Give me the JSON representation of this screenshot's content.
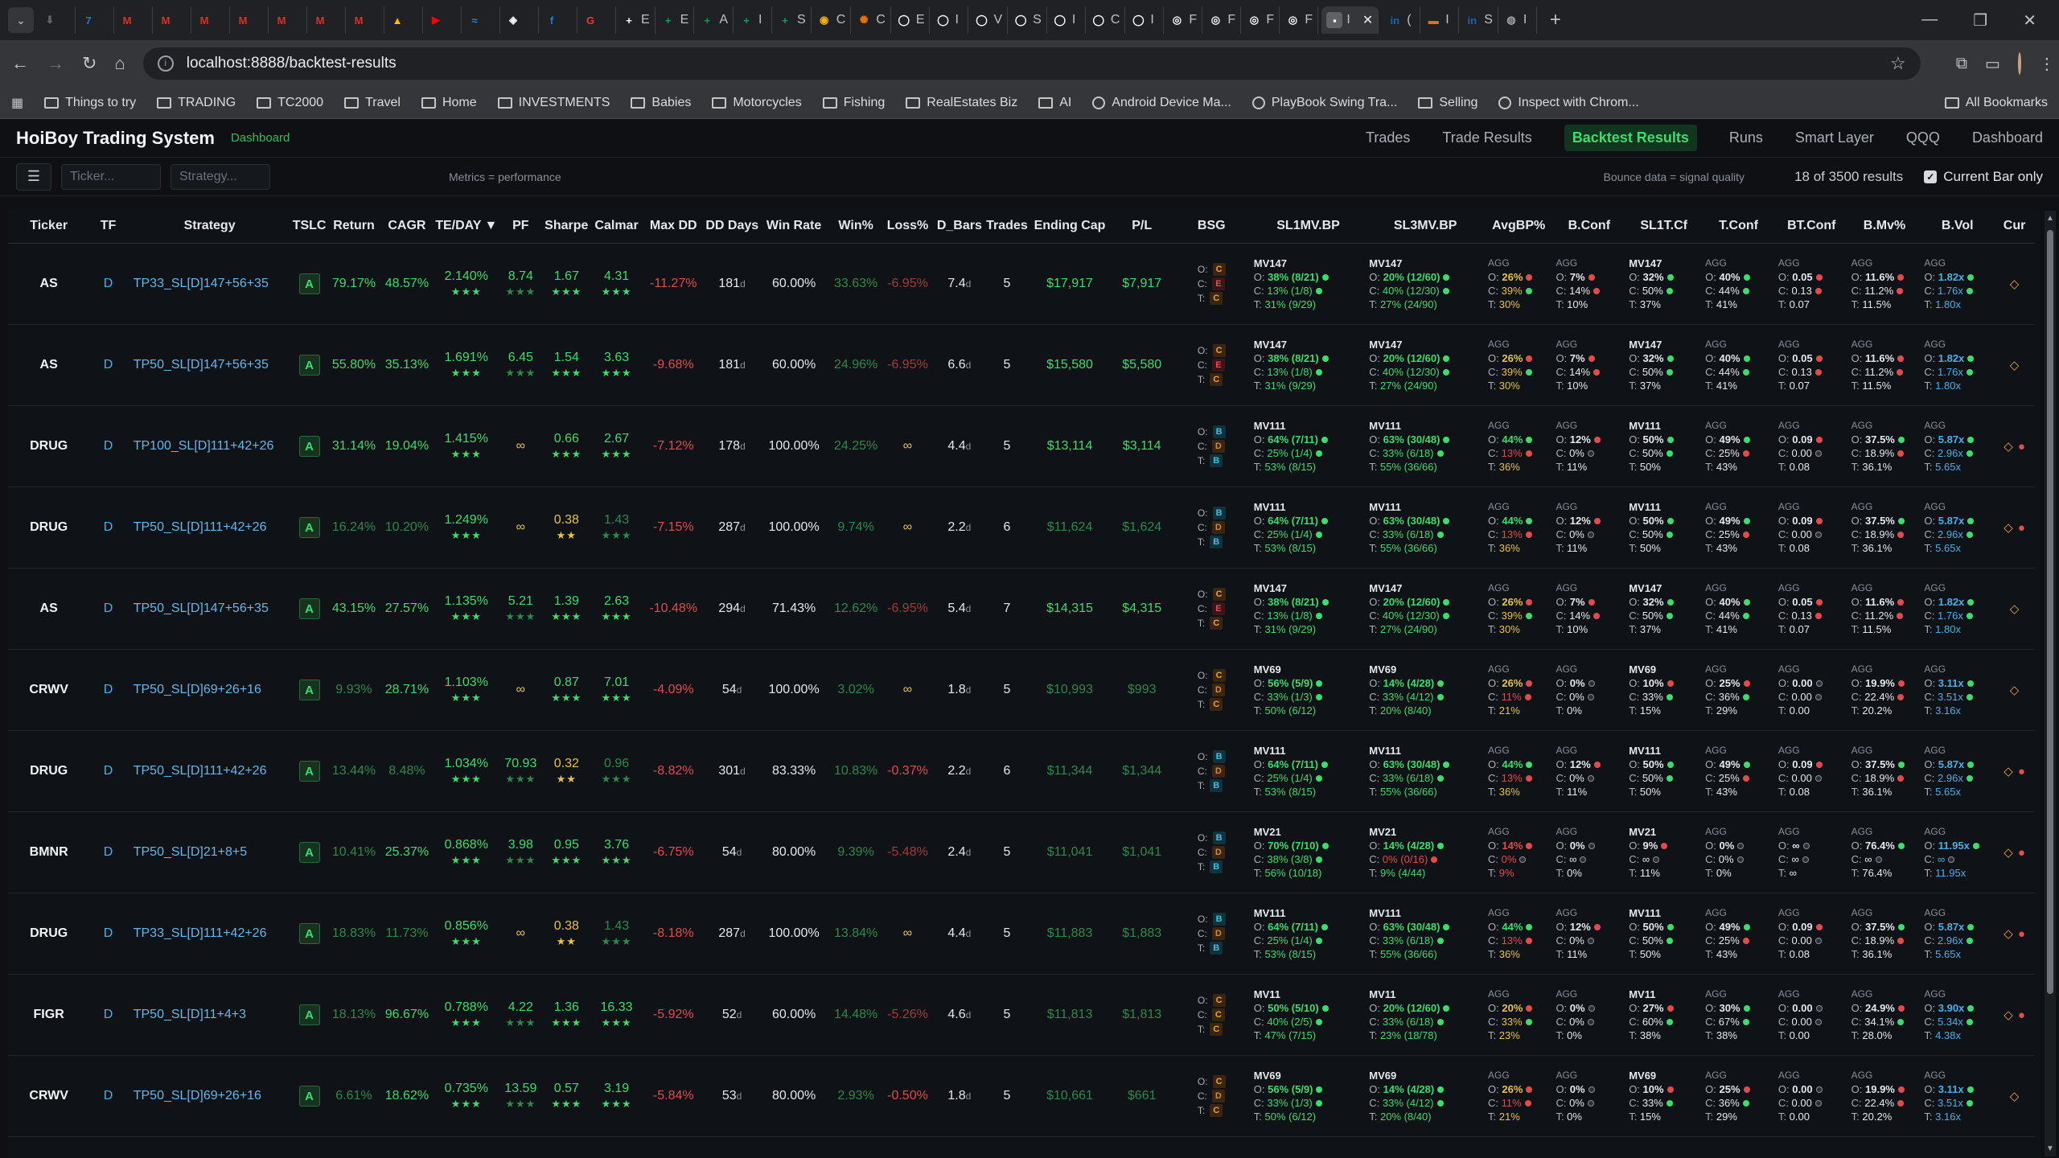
{
  "browser": {
    "tabs": [
      {
        "glyph": "⬇",
        "color": "#5f6368"
      },
      {
        "glyph": "7",
        "color": "#1a73e8"
      },
      {
        "glyph": "M",
        "color": "#d93025"
      },
      {
        "glyph": "M",
        "color": "#d93025"
      },
      {
        "glyph": "M",
        "color": "#d93025"
      },
      {
        "glyph": "M",
        "color": "#d93025"
      },
      {
        "glyph": "M",
        "color": "#d93025"
      },
      {
        "glyph": "M",
        "color": "#d93025"
      },
      {
        "glyph": "M",
        "color": "#d93025"
      },
      {
        "glyph": "▲",
        "color": "#fbbc04"
      },
      {
        "glyph": "▶",
        "color": "#ff0000"
      },
      {
        "glyph": "≈",
        "color": "#1e88e5"
      },
      {
        "glyph": "◈",
        "color": "#ffffff"
      },
      {
        "glyph": "f",
        "color": "#1877f2"
      },
      {
        "glyph": "G",
        "color": "#e53935"
      },
      {
        "glyph": "+",
        "color": "#ffffff",
        "label": "E"
      },
      {
        "glyph": "+",
        "color": "#0f9d58",
        "label": "E"
      },
      {
        "glyph": "+",
        "color": "#0f9d58",
        "label": "A"
      },
      {
        "glyph": "+",
        "color": "#0f9d58",
        "label": "I"
      },
      {
        "glyph": "+",
        "color": "#0f9d58",
        "label": "S"
      },
      {
        "glyph": "◉",
        "color": "#f4b400",
        "label": "C"
      },
      {
        "glyph": "✺",
        "color": "#e8710a",
        "label": "C"
      },
      {
        "glyph": "◯",
        "color": "#ffffff",
        "label": "E"
      },
      {
        "glyph": "◯",
        "color": "#ffffff",
        "label": "I"
      },
      {
        "glyph": "◯",
        "color": "#ffffff",
        "label": "V"
      },
      {
        "glyph": "◯",
        "color": "#ffffff",
        "label": "S"
      },
      {
        "glyph": "◯",
        "color": "#ffffff",
        "label": "I"
      },
      {
        "glyph": "◯",
        "color": "#ffffff",
        "label": "C"
      },
      {
        "glyph": "◯",
        "color": "#ffffff",
        "label": "I"
      },
      {
        "glyph": "◎",
        "color": "#ffffff",
        "label": "F"
      },
      {
        "glyph": "◎",
        "color": "#ffffff",
        "label": "F"
      },
      {
        "glyph": "◎",
        "color": "#ffffff",
        "label": "F"
      },
      {
        "glyph": "◎",
        "color": "#ffffff",
        "label": "F"
      }
    ],
    "active_tab": {
      "label": "I"
    },
    "tabs_after": [
      {
        "glyph": "in",
        "color": "#0a66c2",
        "label": "("
      },
      {
        "glyph": "▬",
        "color": "#e8710a",
        "label": "I"
      },
      {
        "glyph": "in",
        "color": "#0a66c2",
        "label": "S"
      },
      {
        "glyph": "◍",
        "color": "#9aa0a6",
        "label": "I"
      }
    ],
    "url": "localhost:8888/backtest-results",
    "bookmarks": [
      "Things to try",
      "TRADING",
      "TC2000",
      "Travel",
      "Home",
      "INVESTMENTS",
      "Babies",
      "Motorcycles",
      "Fishing",
      "RealEstates Biz",
      "AI",
      "Android Device Ma...",
      "PlayBook Swing Tra...",
      "Selling",
      "Inspect with Chrom..."
    ],
    "all_bookmarks": "All Bookmarks"
  },
  "app": {
    "brand": "HoiBoy Trading System",
    "brand_sub": "Dashboard",
    "nav": [
      "Trades",
      "Trade Results",
      "Backtest Results",
      "Runs",
      "Smart Layer",
      "QQQ",
      "Dashboard"
    ],
    "nav_active": "Backtest Results"
  },
  "filters": {
    "ticker_placeholder": "Ticker...",
    "strategy_placeholder": "Strategy...",
    "metrics_note": "Metrics = performance",
    "bounce_note": "Bounce data = signal quality",
    "result_count": "18 of 3500 results",
    "current_bar_label": "Current Bar only",
    "current_bar_checked": true
  },
  "columns": [
    "Ticker",
    "TF",
    "Strategy",
    "TSLC",
    "Return",
    "CAGR",
    "TE/DAY ▼",
    "PF",
    "Sharpe",
    "Calmar",
    "Max DD",
    "DD Days",
    "Win Rate",
    "Win%",
    "Loss%",
    "D_Bars",
    "Trades",
    "Ending Cap",
    "P/L",
    "BSG",
    "SL1MV.BP",
    "SL3MV.BP",
    "AvgBP%",
    "B.Conf",
    "SL1T.Cf",
    "T.Conf",
    "BT.Conf",
    "B.Mv%",
    "B.Vol",
    "Cur"
  ],
  "rows": [
    {
      "ticker": "AS",
      "tf": "D",
      "strategy": "TP33_SL[D]147+56+35",
      "tslc": "A",
      "ret": "79.17%",
      "cagr": "48.57%",
      "teday": "2.140%",
      "pf": "8.74",
      "sharpe": "1.67",
      "calmar": "4.31",
      "maxdd": "-11.27%",
      "dddays": "181",
      "winrate": "60.00%",
      "winp": "33.63%",
      "lossp": "-6.95%",
      "dbars": "7.4",
      "trades": "5",
      "endcap": "$17,917",
      "pl": "$7,917",
      "bsg": [
        "C",
        "E",
        "C"
      ]
    },
    {
      "ticker": "AS",
      "tf": "D",
      "strategy": "TP50_SL[D]147+56+35",
      "tslc": "A",
      "ret": "55.80%",
      "cagr": "35.13%",
      "teday": "1.691%",
      "pf": "6.45",
      "sharpe": "1.54",
      "calmar": "3.63",
      "maxdd": "-9.68%",
      "dddays": "181",
      "winrate": "60.00%",
      "winp": "24.96%",
      "lossp": "-6.95%",
      "dbars": "6.6",
      "trades": "5",
      "endcap": "$15,580",
      "pl": "$5,580",
      "bsg": [
        "C",
        "E",
        "C"
      ]
    },
    {
      "ticker": "DRUG",
      "tf": "D",
      "strategy": "TP100_SL[D]111+42+26",
      "tslc": "A",
      "ret": "31.14%",
      "cagr": "19.04%",
      "teday": "1.415%",
      "pf": "∞",
      "sharpe": "0.66",
      "calmar": "2.67",
      "maxdd": "-7.12%",
      "dddays": "178",
      "winrate": "100.00%",
      "winp": "24.25%",
      "lossp": "∞",
      "dbars": "4.4",
      "trades": "5",
      "endcap": "$13,114",
      "pl": "$3,114",
      "bsg": [
        "B",
        "D",
        "B"
      ]
    },
    {
      "ticker": "DRUG",
      "tf": "D",
      "strategy": "TP50_SL[D]111+42+26",
      "tslc": "A",
      "ret": "16.24%",
      "cagr": "10.20%",
      "teday": "1.249%",
      "pf": "∞",
      "sharpe": "0.38",
      "calmar": "1.43",
      "maxdd": "-7.15%",
      "dddays": "287",
      "winrate": "100.00%",
      "winp": "9.74%",
      "lossp": "∞",
      "dbars": "2.2",
      "trades": "6",
      "endcap": "$11,624",
      "pl": "$1,624",
      "bsg": [
        "B",
        "D",
        "B"
      ]
    },
    {
      "ticker": "AS",
      "tf": "D",
      "strategy": "TP50_SL[D]147+56+35",
      "tslc": "A",
      "ret": "43.15%",
      "cagr": "27.57%",
      "teday": "1.135%",
      "pf": "5.21",
      "sharpe": "1.39",
      "calmar": "2.63",
      "maxdd": "-10.48%",
      "dddays": "294",
      "winrate": "71.43%",
      "winp": "12.62%",
      "lossp": "-6.95%",
      "dbars": "5.4",
      "trades": "7",
      "endcap": "$14,315",
      "pl": "$4,315",
      "bsg": [
        "C",
        "E",
        "C"
      ]
    },
    {
      "ticker": "CRWV",
      "tf": "D",
      "strategy": "TP50_SL[D]69+26+16",
      "tslc": "A",
      "ret": "9.93%",
      "cagr": "28.71%",
      "teday": "1.103%",
      "pf": "∞",
      "sharpe": "0.87",
      "calmar": "7.01",
      "maxdd": "-4.09%",
      "dddays": "54",
      "winrate": "100.00%",
      "winp": "3.02%",
      "lossp": "∞",
      "dbars": "1.8",
      "trades": "5",
      "endcap": "$10,993",
      "pl": "$993",
      "bsg": [
        "C",
        "D",
        "C"
      ]
    },
    {
      "ticker": "DRUG",
      "tf": "D",
      "strategy": "TP50_SL[D]111+42+26",
      "tslc": "A",
      "ret": "13.44%",
      "cagr": "8.48%",
      "teday": "1.034%",
      "pf": "70.93",
      "sharpe": "0.32",
      "calmar": "0.96",
      "maxdd": "-8.82%",
      "dddays": "301",
      "winrate": "83.33%",
      "winp": "10.83%",
      "lossp": "-0.37%",
      "dbars": "2.2",
      "trades": "6",
      "endcap": "$11,344",
      "pl": "$1,344",
      "bsg": [
        "B",
        "D",
        "B"
      ]
    },
    {
      "ticker": "BMNR",
      "tf": "D",
      "strategy": "TP50_SL[D]21+8+5",
      "tslc": "A",
      "ret": "10.41%",
      "cagr": "25.37%",
      "teday": "0.868%",
      "pf": "3.98",
      "sharpe": "0.95",
      "calmar": "3.76",
      "maxdd": "-6.75%",
      "dddays": "54",
      "winrate": "80.00%",
      "winp": "9.39%",
      "lossp": "-5.48%",
      "dbars": "2.4",
      "trades": "5",
      "endcap": "$11,041",
      "pl": "$1,041",
      "bsg": [
        "B",
        "D",
        "B"
      ]
    },
    {
      "ticker": "DRUG",
      "tf": "D",
      "strategy": "TP33_SL[D]111+42+26",
      "tslc": "A",
      "ret": "18.83%",
      "cagr": "11.73%",
      "teday": "0.856%",
      "pf": "∞",
      "sharpe": "0.38",
      "calmar": "1.43",
      "maxdd": "-8.18%",
      "dddays": "287",
      "winrate": "100.00%",
      "winp": "13.84%",
      "lossp": "∞",
      "dbars": "4.4",
      "trades": "5",
      "endcap": "$11,883",
      "pl": "$1,883",
      "bsg": [
        "B",
        "D",
        "B"
      ]
    },
    {
      "ticker": "FIGR",
      "tf": "D",
      "strategy": "TP50_SL[D]11+4+3",
      "tslc": "A",
      "ret": "18.13%",
      "cagr": "96.67%",
      "teday": "0.788%",
      "pf": "4.22",
      "sharpe": "1.36",
      "calmar": "16.33",
      "maxdd": "-5.92%",
      "dddays": "52",
      "winrate": "60.00%",
      "winp": "14.48%",
      "lossp": "-5.26%",
      "dbars": "4.6",
      "trades": "5",
      "endcap": "$11,813",
      "pl": "$1,813",
      "bsg": [
        "C",
        "C",
        "C"
      ]
    },
    {
      "ticker": "CRWV",
      "tf": "D",
      "strategy": "TP50_SL[D]69+26+16",
      "tslc": "A",
      "ret": "6.61%",
      "cagr": "18.62%",
      "teday": "0.735%",
      "pf": "13.59",
      "sharpe": "0.57",
      "calmar": "3.19",
      "maxdd": "-5.84%",
      "dddays": "53",
      "winrate": "80.00%",
      "winp": "2.93%",
      "lossp": "-0.50%",
      "dbars": "1.8",
      "trades": "5",
      "endcap": "$10,661",
      "pl": "$661",
      "bsg": [
        "C",
        "D",
        "C"
      ]
    }
  ],
  "mini_profiles": {
    "AS": {
      "sl1": {
        "hd": "MV147",
        "o": "38% (8/21)",
        "c": "13% (1/8)",
        "t": "31% (9/29)"
      },
      "sl3": {
        "hd": "MV147",
        "o": "20% (12/60)",
        "c": "40% (12/30)",
        "t": "27% (24/90)"
      },
      "avg": {
        "o": "26%",
        "c": "39%",
        "t": "30%"
      },
      "bconf": {
        "o": "7%",
        "c": "14%",
        "t": "10%"
      },
      "sl1t": {
        "hd": "MV147",
        "o": "32%",
        "c": "50%",
        "t": "37%"
      },
      "tconf": {
        "o": "40%",
        "c": "44%",
        "t": "41%"
      },
      "btconf": {
        "o": "0.05",
        "c": "0.13",
        "t": "0.07"
      },
      "bmv": {
        "o": "11.6%",
        "c": "11.2%",
        "t": "11.5%"
      },
      "bvol": {
        "o": "1.82x",
        "c": "1.76x",
        "t": "1.80x"
      }
    },
    "DRUG": {
      "sl1": {
        "hd": "MV111",
        "o": "64% (7/11)",
        "c": "25% (1/4)",
        "t": "53% (8/15)"
      },
      "sl3": {
        "hd": "MV111",
        "o": "63% (30/48)",
        "c": "33% (6/18)",
        "t": "55% (36/66)"
      },
      "avg": {
        "o": "44%",
        "c": "13%",
        "t": "36%"
      },
      "bconf": {
        "o": "12%",
        "c": "0%",
        "t": "11%"
      },
      "sl1t": {
        "hd": "MV111",
        "o": "50%",
        "c": "50%",
        "t": "50%"
      },
      "tconf": {
        "o": "49%",
        "c": "25%",
        "t": "43%"
      },
      "btconf": {
        "o": "0.09",
        "c": "0.00",
        "t": "0.08"
      },
      "bmv": {
        "o": "37.5%",
        "c": "18.9%",
        "t": "36.1%"
      },
      "bvol": {
        "o": "5.87x",
        "c": "2.96x",
        "t": "5.65x"
      }
    },
    "CRWV": {
      "sl1": {
        "hd": "MV69",
        "o": "56% (5/9)",
        "c": "33% (1/3)",
        "t": "50% (6/12)"
      },
      "sl3": {
        "hd": "MV69",
        "o": "14% (4/28)",
        "c": "33% (4/12)",
        "t": "20% (8/40)"
      },
      "avg": {
        "o": "26%",
        "c": "11%",
        "t": "21%"
      },
      "bconf": {
        "o": "0%",
        "c": "0%",
        "t": "0%"
      },
      "sl1t": {
        "hd": "MV69",
        "o": "10%",
        "c": "33%",
        "t": "15%"
      },
      "tconf": {
        "o": "25%",
        "c": "36%",
        "t": "29%"
      },
      "btconf": {
        "o": "0.00",
        "c": "0.00",
        "t": "0.00"
      },
      "bmv": {
        "o": "19.9%",
        "c": "22.4%",
        "t": "20.2%"
      },
      "bvol": {
        "o": "3.11x",
        "c": "3.51x",
        "t": "3.16x"
      }
    },
    "BMNR": {
      "sl1": {
        "hd": "MV21",
        "o": "70% (7/10)",
        "c": "38% (3/8)",
        "t": "56% (10/18)"
      },
      "sl3": {
        "hd": "MV21",
        "o": "14% (4/28)",
        "c": "0% (0/16)",
        "t": "9% (4/44)"
      },
      "avg": {
        "o": "14%",
        "c": "0%",
        "t": "9%"
      },
      "bconf": {
        "o": "0%",
        "c": "∞",
        "t": "0%"
      },
      "sl1t": {
        "hd": "MV21",
        "o": "9%",
        "c": "∞",
        "t": "11%"
      },
      "tconf": {
        "o": "0%",
        "c": "0%",
        "t": "0%"
      },
      "btconf": {
        "o": "∞",
        "c": "∞",
        "t": "∞"
      },
      "bmv": {
        "o": "76.4%",
        "c": "∞",
        "t": "76.4%"
      },
      "bvol": {
        "o": "11.95x",
        "c": "∞",
        "t": "11.95x"
      }
    },
    "FIGR": {
      "sl1": {
        "hd": "MV11",
        "o": "50% (5/10)",
        "c": "40% (2/5)",
        "t": "47% (7/15)"
      },
      "sl3": {
        "hd": "MV11",
        "o": "20% (12/60)",
        "c": "33% (6/18)",
        "t": "23% (18/78)"
      },
      "avg": {
        "o": "20%",
        "c": "33%",
        "t": "23%"
      },
      "bconf": {
        "o": "0%",
        "c": "0%",
        "t": "0%"
      },
      "sl1t": {
        "hd": "MV11",
        "o": "27%",
        "c": "60%",
        "t": "38%"
      },
      "tconf": {
        "o": "30%",
        "c": "67%",
        "t": "38%"
      },
      "btconf": {
        "o": "0.00",
        "c": "0.00",
        "t": "0.00"
      },
      "bmv": {
        "o": "24.9%",
        "c": "34.1%",
        "t": "28.0%"
      },
      "bvol": {
        "o": "3.90x",
        "c": "5.34x",
        "t": "4.38x"
      }
    }
  },
  "agg_label": "AGG"
}
